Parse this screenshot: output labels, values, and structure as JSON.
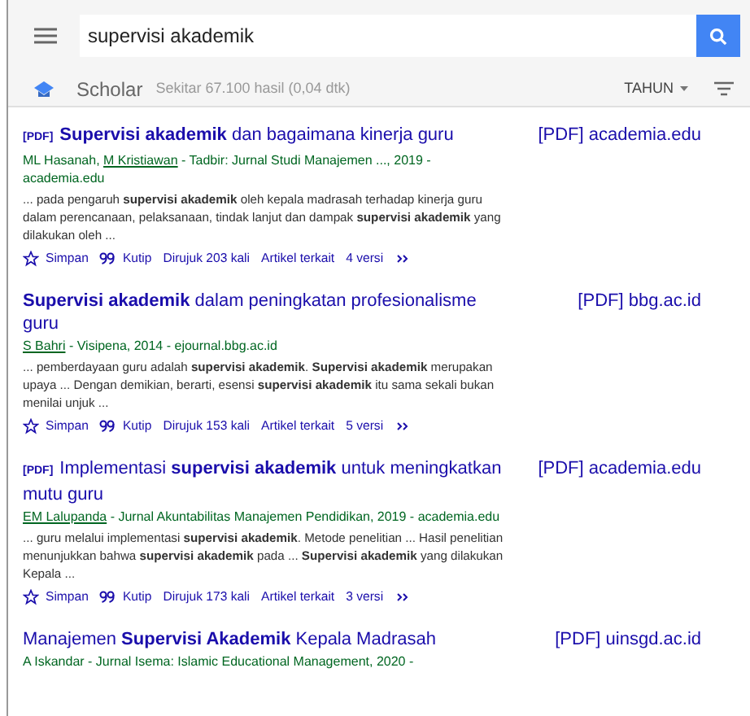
{
  "search": {
    "value": "supervisi akademik"
  },
  "scholar_bar": {
    "brand": "Scholar",
    "result_count": "Sekitar 67.100 hasil (0,04 dtk)",
    "year_filter": "TAHUN"
  },
  "results": [
    {
      "pdf_tag": "[PDF]",
      "title": "**Supervisi akademik** dan bagaimana kinerja guru",
      "source_link": "[PDF] academia.edu",
      "meta": [
        {
          "text": "ML Hasanah, ",
          "link": false
        },
        {
          "text": "M Kristiawan",
          "link": true
        },
        {
          "text": " - Tadbir: Jurnal Studi Manajemen ..., 2019 - academia.edu",
          "link": false
        }
      ],
      "snippet": "... pada pengaruh **supervisi akademik** oleh kepala madrasah terhadap kinerja guru dalam perencanaan, pelaksanaan, tindak lanjut dan dampak **supervisi akademik** yang dilakukan oleh ...",
      "actions": [
        {
          "kind": "save",
          "label": "Simpan"
        },
        {
          "kind": "cite",
          "label": "Kutip"
        },
        {
          "kind": "text",
          "label": "Dirujuk 203 kali"
        },
        {
          "kind": "text",
          "label": "Artikel terkait"
        },
        {
          "kind": "text",
          "label": "4 versi"
        },
        {
          "kind": "more"
        }
      ]
    },
    {
      "title": "**Supervisi akademik** dalam peningkatan profesionalisme guru",
      "source_link": "[PDF] bbg.ac.id",
      "meta": [
        {
          "text": "S Bahri",
          "link": true
        },
        {
          "text": " - Visipena, 2014 - ejournal.bbg.ac.id",
          "link": false
        }
      ],
      "snippet": "... pemberdayaan guru adalah **supervisi akademik**. **Supervisi akademik** merupakan upaya ... Dengan demikian, berarti, esensi **supervisi akademik** itu sama sekali bukan menilai unjuk ...",
      "actions": [
        {
          "kind": "save",
          "label": "Simpan"
        },
        {
          "kind": "cite",
          "label": "Kutip"
        },
        {
          "kind": "text",
          "label": "Dirujuk 153 kali"
        },
        {
          "kind": "text",
          "label": "Artikel terkait"
        },
        {
          "kind": "text",
          "label": "5 versi"
        },
        {
          "kind": "more"
        }
      ]
    },
    {
      "pdf_tag": "[PDF]",
      "title": "Implementasi **supervisi akademik** untuk meningkatkan mutu guru",
      "source_link": "[PDF] academia.edu",
      "meta": [
        {
          "text": "EM Lalupanda",
          "link": true
        },
        {
          "text": " - Jurnal Akuntabilitas Manajemen Pendidikan, 2019 - academia.edu",
          "link": false
        }
      ],
      "snippet": "... guru melalui implementasi **supervisi akademik**. Metode penelitian ... Hasil penelitian menunjukkan bahwa **supervisi akademik** pada ... **Supervisi akademik** yang dilakukan Kepala ...",
      "actions": [
        {
          "kind": "save",
          "label": "Simpan"
        },
        {
          "kind": "cite",
          "label": "Kutip"
        },
        {
          "kind": "text",
          "label": "Dirujuk 173 kali"
        },
        {
          "kind": "text",
          "label": "Artikel terkait"
        },
        {
          "kind": "text",
          "label": "3 versi"
        },
        {
          "kind": "more"
        }
      ]
    },
    {
      "title": "Manajemen **Supervisi Akademik** Kepala Madrasah",
      "source_link": "[PDF] uinsgd.ac.id",
      "meta": [
        {
          "text": "A Iskandar - Jurnal Isema: Islamic Educational Management, 2020 -",
          "link": false
        }
      ]
    }
  ]
}
